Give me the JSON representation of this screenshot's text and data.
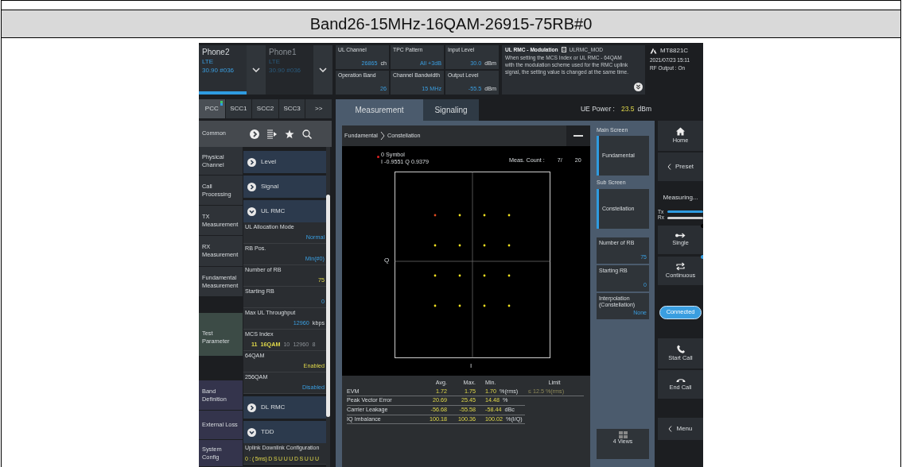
{
  "document": {
    "title": "Band26-15MHz-16QAM-26915-75RB#0"
  },
  "phones": [
    {
      "name": "Phone2",
      "system": "LTE",
      "channel": "30.90 #036",
      "selected": true
    },
    {
      "name": "Phone1",
      "system": "LTE",
      "channel": "30.90 #036",
      "selected": false
    }
  ],
  "params": [
    {
      "label": "UL Channel",
      "value": "26865",
      "unit": "ch"
    },
    {
      "label": "TPC Pattern",
      "value": "All +3dB"
    },
    {
      "label": "Input Level",
      "value": "30.0",
      "unit": "dBm"
    },
    {
      "label": "Operation Band",
      "value": "26"
    },
    {
      "label": "Channel Bandwidth",
      "value": "15 MHz"
    },
    {
      "label": "Output Level",
      "value": "-55.5",
      "unit": "dBm"
    }
  ],
  "info": {
    "title": "UL RMC - Modulation",
    "ident": "ULRMC_MOD",
    "text": "When setting the MCS Index or UL RMC - 64QAM with the modulation scheme used for the RMC uplink signal, the setting value is changed at the same time."
  },
  "instrument": {
    "model": "MT8821C",
    "datetime": "2021/07/23 15:11",
    "rf_output": "RF Output : On"
  },
  "carriers": [
    {
      "label": "PCC",
      "selected": true
    },
    {
      "label": "SCC1",
      "selected": false
    },
    {
      "label": "SCC2",
      "selected": false
    },
    {
      "label": "SCC3",
      "selected": false
    },
    {
      "label": ">>",
      "selected": false
    }
  ],
  "main_tabs": [
    {
      "label": "Measurement",
      "selected": true
    },
    {
      "label": "Signaling",
      "selected": false
    }
  ],
  "ue_power": {
    "label": "UE Power :",
    "value": "23.5",
    "unit": "dBm"
  },
  "sidebar": {
    "header": "Common",
    "items": [
      {
        "label": "Physical Channel",
        "kind": "measure",
        "selected": false
      },
      {
        "label": "Call Processing",
        "kind": "measure",
        "selected": false
      },
      {
        "label": "TX Measurement",
        "kind": "measure",
        "selected": false
      },
      {
        "label": "RX Measurement",
        "kind": "measure",
        "selected": false
      },
      {
        "label": "Fundamental Measurement",
        "kind": "measure",
        "selected": false
      },
      {
        "label": "Test Parameter",
        "kind": "test",
        "selected": true
      },
      {
        "label": "Band Definition",
        "kind": "setup",
        "selected": false
      },
      {
        "label": "External Loss",
        "kind": "setup",
        "selected": false
      },
      {
        "label": "System Config",
        "kind": "setup",
        "selected": false
      }
    ]
  },
  "settings": [
    {
      "title": "Level",
      "expanded": false
    },
    {
      "title": "Signal",
      "expanded": false
    },
    {
      "title": "UL RMC",
      "expanded": true,
      "rows": [
        {
          "label": "UL Allocation Mode",
          "values": [
            {
              "text": "Normal",
              "kind": "value"
            }
          ]
        },
        {
          "label": "RB Pos.",
          "values": [
            {
              "text": "Min(#0)",
              "kind": "value"
            }
          ]
        },
        {
          "label": "Number of RB",
          "values": [
            {
              "text": "75",
              "kind": "changed"
            }
          ]
        },
        {
          "label": "Starting RB",
          "values": [
            {
              "text": "0",
              "kind": "value"
            }
          ]
        },
        {
          "label": "Max UL Throughput",
          "values": [
            {
              "text": "12960",
              "kind": "value"
            }
          ],
          "unit": "kbps"
        },
        {
          "label": "MCS Index",
          "values": [
            {
              "text": "11",
              "kind": "changed"
            },
            {
              "text": "16QAM",
              "kind": "changed"
            },
            {
              "text": "10",
              "kind": "info"
            },
            {
              "text": "12960",
              "kind": "info"
            },
            {
              "text": "8",
              "kind": "info"
            }
          ]
        },
        {
          "label": "64QAM",
          "values": [
            {
              "text": "Enabled",
              "kind": "changed"
            }
          ]
        },
        {
          "label": "256QAM",
          "values": [
            {
              "text": "Disabled",
              "kind": "value"
            }
          ]
        }
      ]
    },
    {
      "title": "DL RMC",
      "expanded": false
    },
    {
      "title": "TDD",
      "expanded": true,
      "rows": [
        {
          "label": "Uplink Downlink Configuration",
          "values": [
            {
              "text": "0 : ( 5ms) D S U U U D S U U U",
              "kind": "changed"
            }
          ]
        }
      ]
    }
  ],
  "breadcrumb": [
    "Fundamental",
    "Constellation"
  ],
  "constellation": {
    "marker_label": "0 Symbol",
    "marker_value": "I -0.9551 Q 0.9379",
    "count_label": "Meas. Count :",
    "count": "7/",
    "count_total": "20",
    "y_axis": "Q",
    "x_axis": "I"
  },
  "results": {
    "columns": [
      "Avg.",
      "Max.",
      "Min.",
      "Limit"
    ],
    "rows": [
      {
        "name": "EVM",
        "avg": "1.72",
        "max": "1.75",
        "min": "1.70",
        "unit": "%(rms)",
        "limit": "≤ 12.5 %(rms)"
      },
      {
        "name": "Peak Vector Error",
        "avg": "20.69",
        "max": "25.45",
        "min": "14.48",
        "unit": "%"
      },
      {
        "name": "Carrier Leakage",
        "avg": "-56.68",
        "max": "-55.58",
        "min": "-58.44",
        "unit": "dBc"
      },
      {
        "name": "IQ Imbalance",
        "avg": "100.18",
        "max": "100.36",
        "min": "100.02",
        "unit": "%(I/Q)"
      }
    ]
  },
  "screens": [
    {
      "label": "Main Screen",
      "button": "Fundamental"
    },
    {
      "label": "Sub Screen",
      "button": "Constellation"
    }
  ],
  "side_params": [
    {
      "label": "Number of RB",
      "value": "75"
    },
    {
      "label": "Starting RB",
      "value": "0"
    },
    {
      "label": "Interpolation (Constellation)",
      "value": "None"
    }
  ],
  "views_button": "4 Views",
  "controls": {
    "home": "Home",
    "preset": "Preset",
    "status": "Measuring...",
    "meters": [
      {
        "label": "Tx",
        "active": true
      },
      {
        "label": "Rx",
        "active": false
      }
    ],
    "modes": [
      {
        "label": "Single",
        "kind": "single",
        "selected": false
      },
      {
        "label": "Continuous",
        "kind": "continuous",
        "selected": true
      }
    ],
    "connection": "Connected",
    "start_call": "Start Call",
    "end_call": "End Call",
    "menu": "Menu"
  }
}
